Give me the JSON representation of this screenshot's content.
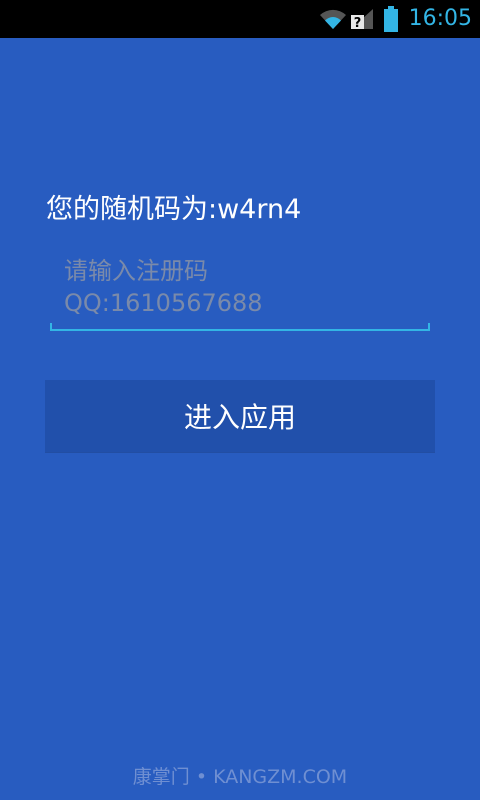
{
  "status_bar": {
    "time": "16:05",
    "icons": [
      "wifi-icon",
      "signal-unknown-icon",
      "battery-icon"
    ],
    "clock_color": "#33b5e5"
  },
  "main": {
    "code_label": "您的随机码为:w4rn4",
    "input": {
      "value": "",
      "placeholder": "请输入注册码\nQQ:1610567688"
    },
    "enter_button_label": "进入应用"
  },
  "watermark": "康掌门 • KANGZM.COM",
  "colors": {
    "background": "#285cc0",
    "button": "#2150ab",
    "accent": "#33b5e5"
  }
}
